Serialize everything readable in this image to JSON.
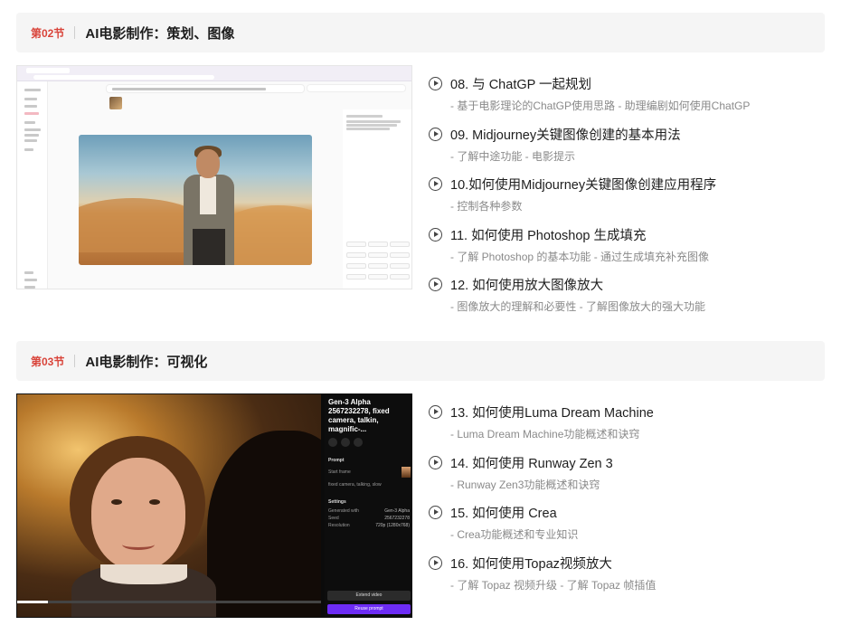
{
  "sections": [
    {
      "number": "第02节",
      "title": "AI电影制作：策划、图像",
      "lessons": [
        {
          "title": "08. 与 ChatGP 一起规划",
          "desc": "- 基于电影理论的ChatGP使用思路 - 助理编剧如何使用ChatGP"
        },
        {
          "title": "09. Midjourney关键图像创建的基本用法",
          "desc": "- 了解中途功能 - 电影提示"
        },
        {
          "title": "10.如何使用Midjourney关键图像创建应用程序",
          "desc": "- 控制各种参数"
        },
        {
          "title": "11. 如何使用 Photoshop 生成填充",
          "desc": "- 了解 Photoshop 的基本功能 - 通过生成填充补充图像"
        },
        {
          "title": "12. 如何使用放大图像放大",
          "desc": "- 图像放大的理解和必要性 - 了解图像放大的强大功能"
        }
      ]
    },
    {
      "number": "第03节",
      "title": "AI电影制作：可视化",
      "lessons": [
        {
          "title": "13. 如何使用Luma Dream Machine",
          "desc": "- Luma Dream Machine功能概述和诀窍"
        },
        {
          "title": "14. 如何使用 Runway Zen 3",
          "desc": "- Runway Zen3功能概述和诀窍"
        },
        {
          "title": "15. 如何使用 Crea",
          "desc": "- Crea功能概述和专业知识"
        },
        {
          "title": "16. 如何使用Topaz视频放大",
          "desc": "- 了解 Topaz 视频升级 - 了解 Topaz 帧插值"
        }
      ]
    }
  ],
  "runway": {
    "title": "Gen-3 Alpha 2567232278, fixed camera, talkin, magnific-...",
    "prompt_label": "Prompt",
    "start_frame": "Start frame",
    "prompt_text": "fixed camera, talking, slow",
    "settings_label": "Settings",
    "rows": [
      {
        "label": "Generated with",
        "value": "Gen-3 Alpha"
      },
      {
        "label": "Seed",
        "value": "2567232278"
      },
      {
        "label": "Resolution",
        "value": "720p (1280x768)"
      }
    ],
    "extend_button": "Extend video",
    "reuse_button": "Reuse prompt"
  },
  "colors": {
    "accent": "#d9443a",
    "header_bg": "#f5f5f5",
    "runway_purple": "#6d2cf5"
  }
}
